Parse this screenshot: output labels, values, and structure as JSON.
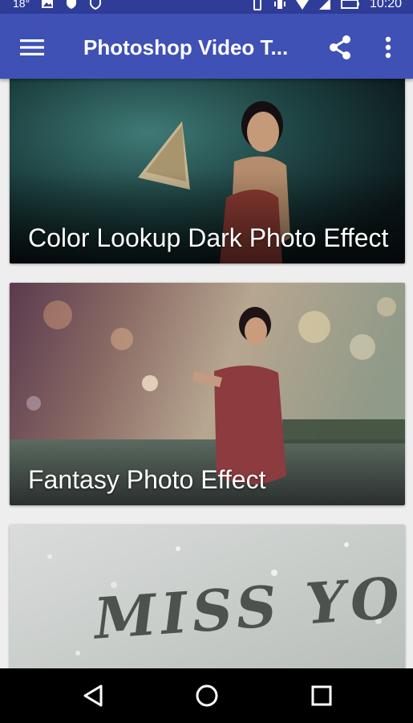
{
  "status_bar": {
    "left_text": "18°",
    "time": "10:20",
    "icons_left": [
      "image-icon",
      "shield-icon",
      "shield-outline-icon"
    ],
    "icons_right": [
      "phone-icon",
      "vibrate-icon",
      "wifi-icon",
      "signal-icon",
      "battery-icon"
    ]
  },
  "app_bar": {
    "title": "Photoshop Video T...",
    "menu_icon": "hamburger-menu-icon",
    "share_icon": "share-icon",
    "more_icon": "more-vert-icon",
    "background_color": "#3f51b5"
  },
  "cards": [
    {
      "title": "Color Lookup Dark Photo Effect"
    },
    {
      "title": "Fantasy Photo Effect"
    },
    {
      "image_text": "MISS YOU"
    }
  ],
  "nav_bar": {
    "back_icon": "back-triangle-icon",
    "home_icon": "home-circle-icon",
    "recent_icon": "recents-square-icon"
  }
}
